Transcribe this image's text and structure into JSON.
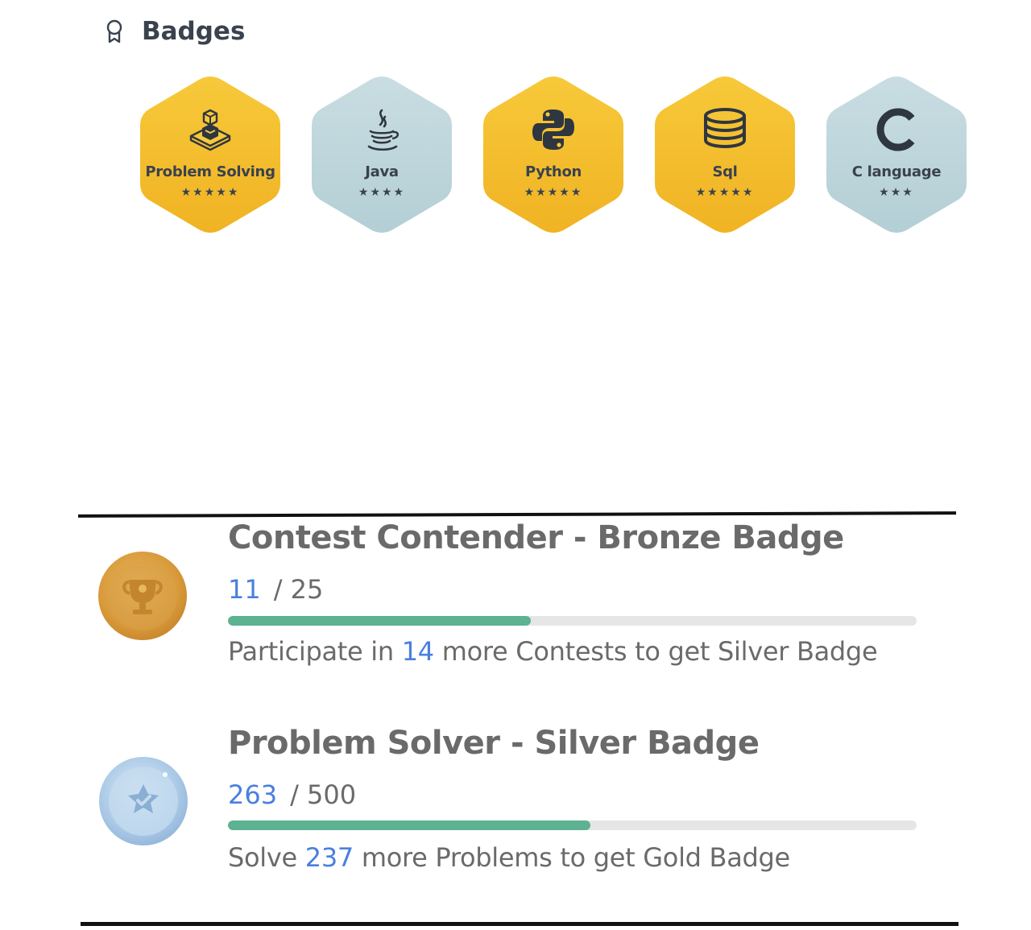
{
  "section": {
    "title": "Badges",
    "icon": "award-ribbon-icon"
  },
  "colors": {
    "gold_badge": "#f3b92c",
    "silver_badge": "#bcd5da",
    "progress_fill": "#5cb291",
    "progress_track": "#e6e6e6",
    "highlight_number": "#4a7fe0",
    "text_muted": "#6a6a6a",
    "text_dark": "#39424e"
  },
  "badges": [
    {
      "label": "Problem Solving",
      "stars": "★★★★★",
      "star_count": 5,
      "tier": "gold",
      "icon": "isometric-puzzle-icon"
    },
    {
      "label": "Java",
      "stars": "★★★★",
      "star_count": 4,
      "tier": "silver",
      "icon": "java-coffee-cup-icon"
    },
    {
      "label": "Python",
      "stars": "★★★★★",
      "star_count": 5,
      "tier": "gold",
      "icon": "python-logo-icon"
    },
    {
      "label": "Sql",
      "stars": "★★★★★",
      "star_count": 5,
      "tier": "gold",
      "icon": "database-stack-icon"
    },
    {
      "label": "C language",
      "stars": "★★★",
      "star_count": 3,
      "tier": "silver",
      "icon": "letter-c-icon"
    }
  ],
  "achievements": [
    {
      "title": "Contest Contender - Bronze Badge",
      "current": "11",
      "total": "/ 25",
      "progress_fraction": 0.44,
      "hint_prefix": "Participate in ",
      "hint_number": "14",
      "hint_suffix": " more Contests to get Silver Badge",
      "medal_icon": "bronze-trophy-medal-icon"
    },
    {
      "title": "Problem Solver - Silver Badge",
      "current": "263",
      "total": "/ 500",
      "progress_fraction": 0.526,
      "hint_prefix": "Solve ",
      "hint_number": "237",
      "hint_suffix": " more Problems to get Gold Badge",
      "medal_icon": "silver-star-medal-icon"
    }
  ]
}
